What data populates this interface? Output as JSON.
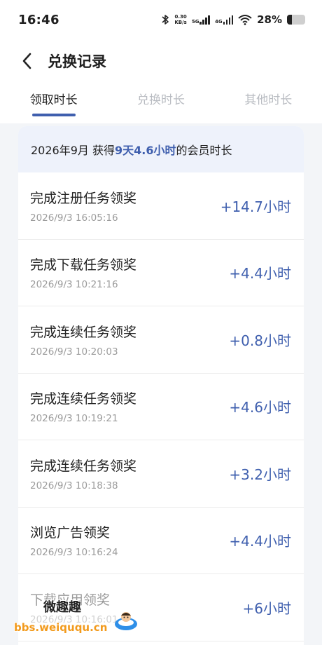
{
  "status": {
    "time": "16:46",
    "net_speed_top": "0.30",
    "net_speed_unit": "KB/s",
    "net1": "5G",
    "net2": "4G",
    "battery": "28%",
    "battery_level": 0.28
  },
  "header": {
    "title": "兑换记录"
  },
  "tabs": [
    {
      "label": "领取时长",
      "active": true
    },
    {
      "label": "兑换时长",
      "active": false
    },
    {
      "label": "其他时长",
      "active": false
    }
  ],
  "summary": {
    "prefix": "2026年9月 获得",
    "highlight": "9天4.6小时",
    "suffix": "的会员时长"
  },
  "records": [
    {
      "name": "完成注册任务领奖",
      "date": "2026/9/3 16:05:16",
      "amount": "+14.7小时"
    },
    {
      "name": "完成下载任务领奖",
      "date": "2026/9/3 10:21:16",
      "amount": "+4.4小时"
    },
    {
      "name": "完成连续任务领奖",
      "date": "2026/9/3 10:20:03",
      "amount": "+0.8小时"
    },
    {
      "name": "完成连续任务领奖",
      "date": "2026/9/3 10:19:21",
      "amount": "+4.6小时"
    },
    {
      "name": "完成连续任务领奖",
      "date": "2026/9/3 10:18:38",
      "amount": "+3.2小时"
    },
    {
      "name": "浏览广告领奖",
      "date": "2026/9/3 10:16:24",
      "amount": "+4.4小时"
    },
    {
      "name": "下载应用领奖",
      "date": "2026/9/3 10:16:01",
      "amount": "+6小时"
    }
  ],
  "watermark": {
    "title": "微趣趣",
    "url": "bbs.weiququ.cn"
  },
  "colors": {
    "accent": "#3f5fae",
    "summary_bg": "#eef2fb",
    "page_bg": "#f3f5f8"
  }
}
